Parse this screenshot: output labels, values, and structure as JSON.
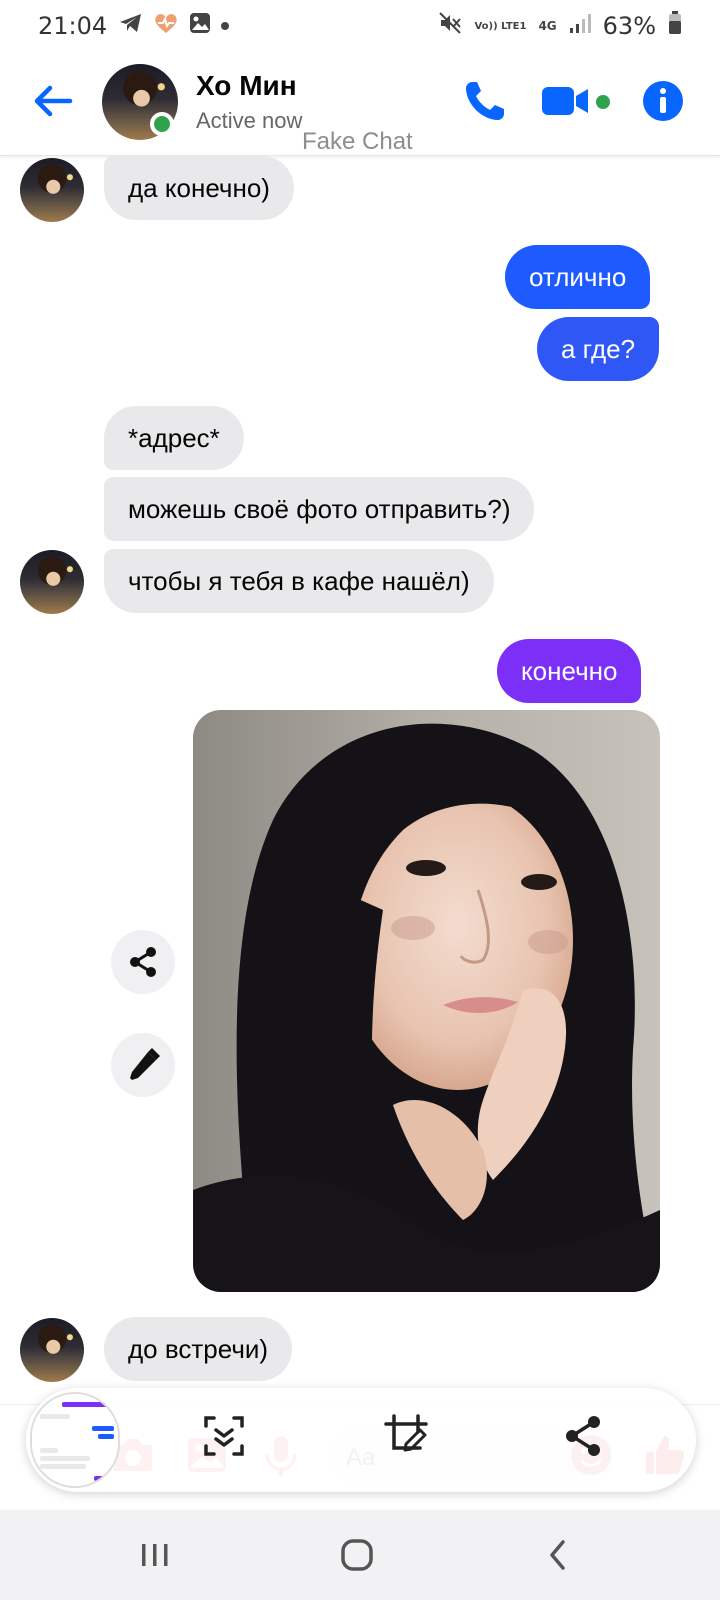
{
  "status_bar": {
    "time": "21:04",
    "battery": "63%",
    "network_top": "Vo)) LTE1",
    "network_type": "4G",
    "icons": [
      "telegram-icon",
      "health-heart-icon",
      "gallery-icon",
      "dot-icon",
      "mute-icon",
      "signal-icon",
      "battery-icon"
    ]
  },
  "header": {
    "contact_name": "Хо Мин",
    "status": "Active now",
    "watermark": "Fake Chat",
    "icons": [
      "back-arrow-icon",
      "phone-icon",
      "video-camera-icon",
      "info-icon"
    ],
    "accent": "#0866ff",
    "online_color": "#31a24c"
  },
  "messages": [
    {
      "sender": "them",
      "text": "да конечно)"
    },
    {
      "sender": "me",
      "text": "отлично"
    },
    {
      "sender": "me",
      "text": "а где?"
    },
    {
      "sender": "them",
      "text": "*адрес*"
    },
    {
      "sender": "them",
      "text": "можешь своё фото отправить?)"
    },
    {
      "sender": "them",
      "text": "чтобы я тебя в кафе нашёл)"
    },
    {
      "sender": "me",
      "text": "конечно"
    },
    {
      "sender": "me",
      "type": "photo"
    },
    {
      "sender": "them",
      "text": "до встречи)"
    }
  ],
  "photo_actions": [
    "share-icon",
    "edit-pencil-icon"
  ],
  "composer": {
    "placeholder": "Aa",
    "icons": [
      "camera-icon",
      "image-icon",
      "microphone-icon",
      "emoji-icon",
      "thumbs-up-icon"
    ]
  },
  "screenshot_toolbar": {
    "icons": [
      "scroll-capture-icon",
      "crop-edit-icon",
      "share-icon"
    ]
  },
  "nav_bar": {
    "icons": [
      "recent-apps-icon",
      "home-icon",
      "back-icon"
    ]
  },
  "colors": {
    "outgoing_blue": "#1e5bff",
    "outgoing_purple": "#7b2ff7",
    "incoming_bg": "#e9e9eb"
  }
}
